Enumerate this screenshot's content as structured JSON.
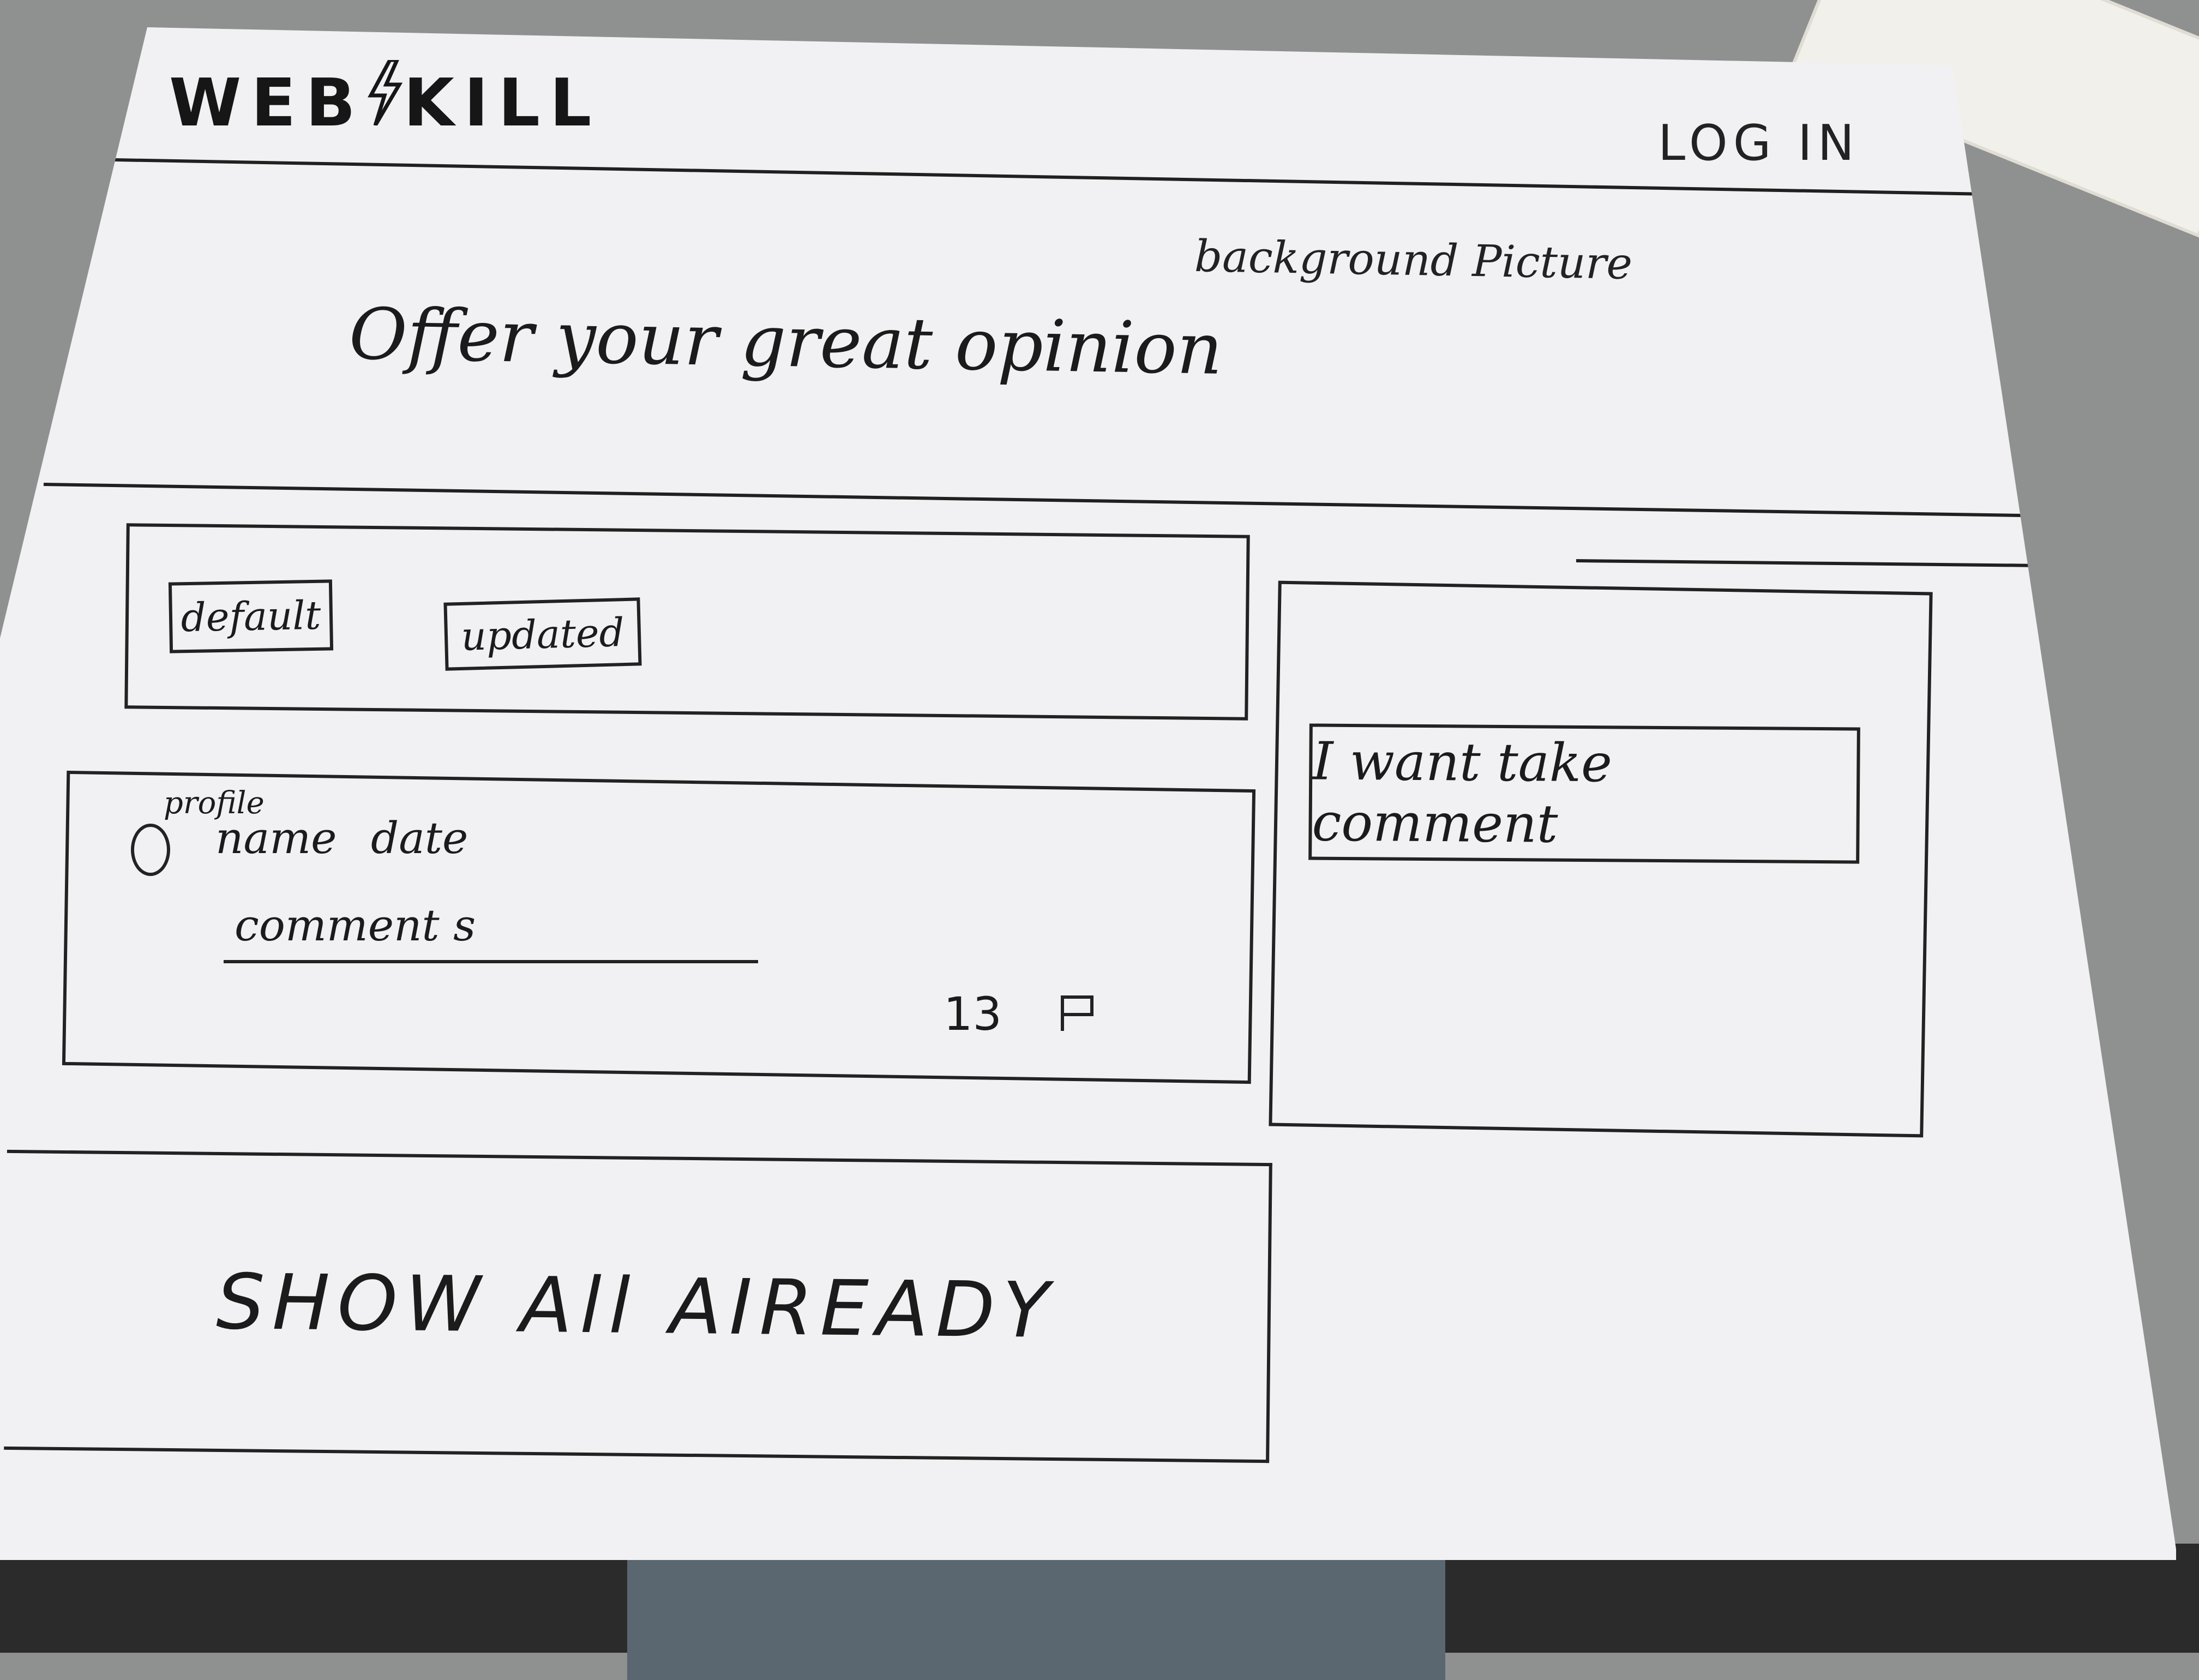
{
  "header": {
    "logo_left": "WEB",
    "logo_right": "KILL",
    "login_label": "LOG IN"
  },
  "hero": {
    "note": "background Picture",
    "title": "Offer your great opinion"
  },
  "sort_tabs": {
    "default_label": "default",
    "updated_label": "updated"
  },
  "comment_card": {
    "profile_note": "profile",
    "name": "name",
    "date": "date",
    "text": "comment s",
    "like_count": "13"
  },
  "sidebar": {
    "write_button_label": "I want take comment"
  },
  "footer": {
    "show_all_label": "SHOW All AIREADY"
  },
  "icons": {
    "logo_bolt": "lightning-bolt-icon",
    "avatar": "profile-circle-icon",
    "report": "flag-icon"
  }
}
